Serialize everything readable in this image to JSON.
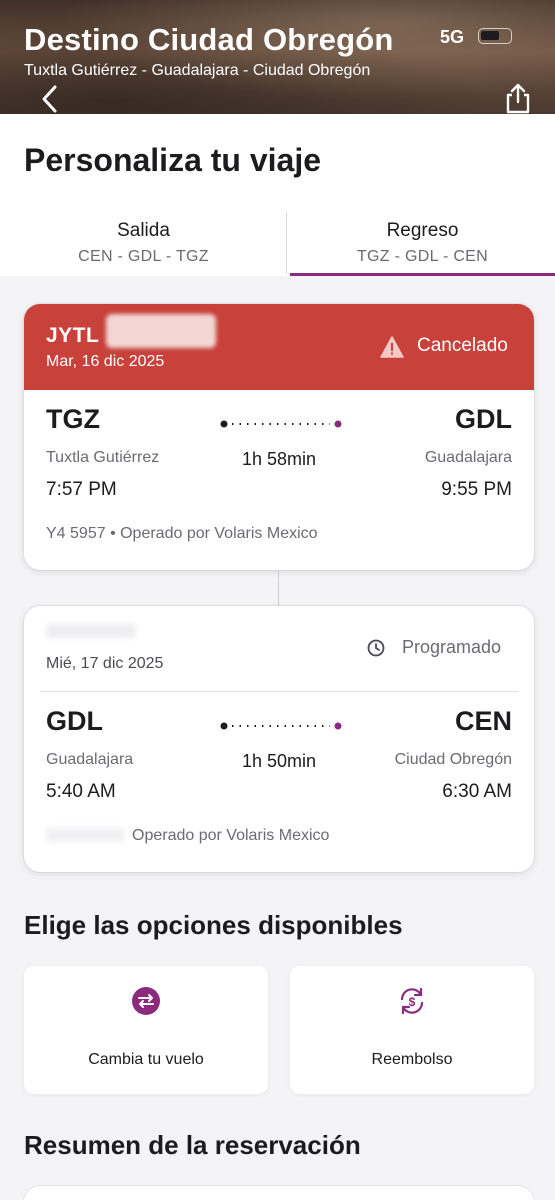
{
  "status_bar": {
    "network": "5G"
  },
  "header": {
    "title": "Destino Ciudad Obregón",
    "route": "Tuxtla Gutiérrez - Guadalajara - Ciudad Obregón"
  },
  "page": {
    "title": "Personaliza tu viaje"
  },
  "tabs": [
    {
      "label": "Salida",
      "route": "CEN - GDL - TGZ",
      "selected": false
    },
    {
      "label": "Regreso",
      "route": "TGZ - GDL - CEN",
      "selected": true
    }
  ],
  "flights": [
    {
      "code": "JYTL",
      "date": "Mar, 16 dic 2025",
      "status": "Cancelado",
      "origin_code": "TGZ",
      "origin_city": "Tuxtla Gutiérrez",
      "departure_time": "7:57 PM",
      "dest_code": "GDL",
      "dest_city": "Guadalajara",
      "arrival_time": "9:55 PM",
      "duration": "1h 58min",
      "flight_number": "Y4 5957",
      "operator": "Operado por Volaris Mexico"
    },
    {
      "date": "Mié, 17 dic 2025",
      "status": "Programado",
      "origin_code": "GDL",
      "origin_city": "Guadalajara",
      "departure_time": "5:40 AM",
      "dest_code": "CEN",
      "dest_city": "Ciudad Obregón",
      "arrival_time": "6:30 AM",
      "duration": "1h 50min",
      "operator": "Operado por Volaris Mexico"
    }
  ],
  "options": {
    "title": "Elige las opciones disponibles",
    "items": [
      {
        "label": "Cambia tu vuelo",
        "icon": "swap-icon"
      },
      {
        "label": "Reembolso",
        "icon": "refund-icon"
      }
    ]
  },
  "summary": {
    "title": "Resumen de la reservación"
  },
  "colors": {
    "accent": "#8a2b7e",
    "cancelled": "#c8413b",
    "text": "#1c1c1e",
    "muted": "#6b6b73"
  }
}
